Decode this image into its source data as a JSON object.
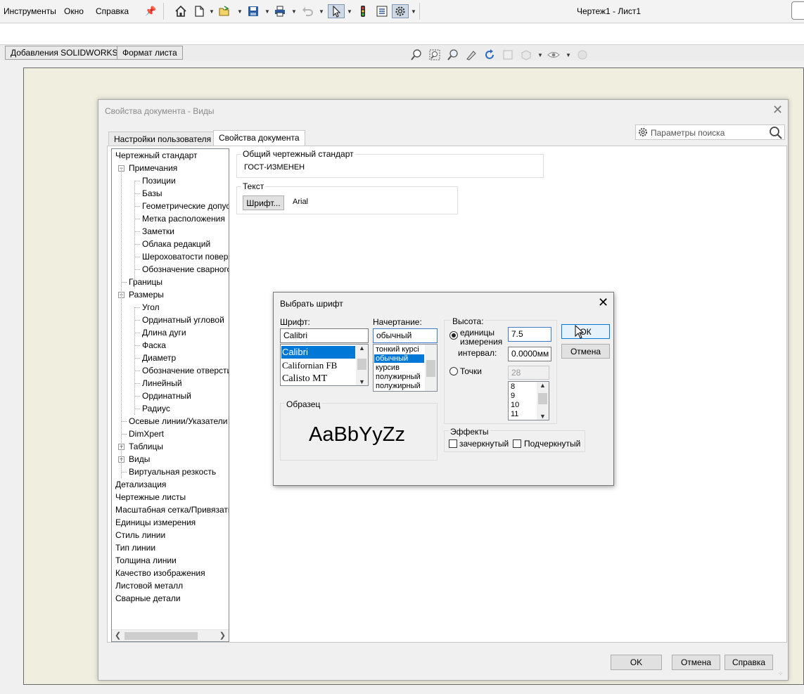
{
  "menu": [
    "Инструменты",
    "Окно",
    "Справка"
  ],
  "doc_title": "Чертеж1 - Лист1",
  "cm_tabs": [
    "Добавления SOLIDWORKS",
    "Формат листа"
  ],
  "doc_props": {
    "title": "Свойства документа - Виды",
    "tabs": [
      "Настройки пользователя",
      "Свойства документа"
    ],
    "search_placeholder": "Параметры поиска",
    "tree": [
      "Чертежный стандарт",
      "Примечания",
      "Позиции",
      "Базы",
      "Геометрические допус",
      "Метка расположения",
      "Заметки",
      "Облака редакций",
      "Шероховатости поверх",
      "Обозначение сварного",
      "Границы",
      "Размеры",
      "Угол",
      "Ординатный угловой",
      "Длина дуги",
      "Фаска",
      "Диаметр",
      "Обозначение отверсти",
      "Линейный",
      "Ординатный",
      "Радиус",
      "Осевые линии/Указатели",
      "DimXpert",
      "Таблицы",
      "Виды",
      "Виртуальная резкость",
      "Детализация",
      "Чертежные листы",
      "Масштабная сетка/Привязать",
      "Единицы измерения",
      "Стиль линии",
      "Тип линии",
      "Толщина линии",
      "Качество изображения",
      "Листовой металл",
      "Сварные детали"
    ],
    "standard_group_label": "Общий чертежный стандарт",
    "standard_value": "ГОСТ-ИЗМЕНЕН",
    "text_group_label": "Текст",
    "font_button": "Шрифт...",
    "font_value": "Arial",
    "buttons": {
      "ok": "OK",
      "cancel": "Отмена",
      "help": "Справка"
    }
  },
  "font_dialog": {
    "title": "Выбрать шрифт",
    "font_label": "Шрифт:",
    "font_value": "Calibri",
    "font_list": [
      "Calibri",
      "Californian FB",
      "Calisto MT"
    ],
    "style_label": "Начертание:",
    "style_value": "обычный",
    "style_list": [
      "тонкий курсі",
      "обычный",
      "курсив",
      "полужирный",
      "полужирный"
    ],
    "height_label": "Высота:",
    "units_label_1": "единицы",
    "units_label_2": "измерения",
    "units_value": "7.5",
    "spacing_label": "интервал:",
    "spacing_value": "0.0000мм",
    "points_label": "Точки",
    "points_value": "28",
    "points_list": [
      "8",
      "9",
      "10",
      "11"
    ],
    "sample_label": "Образец",
    "sample_text": "AaBbYyZz",
    "effects_label": "Эффекты",
    "strike_label": "зачеркнутый",
    "underline_label": "Подчеркнутый",
    "ok": "ОК",
    "cancel": "Отмена"
  }
}
